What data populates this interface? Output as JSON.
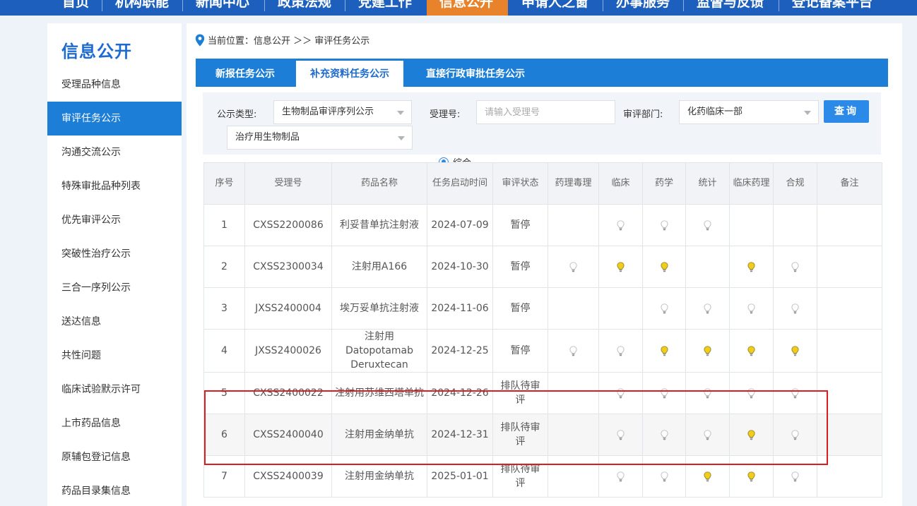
{
  "topnav": {
    "items": [
      {
        "label": "首页",
        "active": false
      },
      {
        "label": "机构职能",
        "active": false
      },
      {
        "label": "新闻中心",
        "active": false
      },
      {
        "label": "政策法规",
        "active": false
      },
      {
        "label": "党建工作",
        "active": false
      },
      {
        "label": "信息公开",
        "active": true
      },
      {
        "label": "申请人之窗",
        "active": false
      },
      {
        "label": "办事服务",
        "active": false
      },
      {
        "label": "监督与反馈",
        "active": false
      },
      {
        "label": "登记备案平台",
        "active": false
      }
    ]
  },
  "sidebar": {
    "title": "信息公开",
    "items": [
      {
        "label": "受理品种信息",
        "active": false
      },
      {
        "label": "审评任务公示",
        "active": true
      },
      {
        "label": "沟通交流公示",
        "active": false
      },
      {
        "label": "特殊审批品种列表",
        "active": false
      },
      {
        "label": "优先审评公示",
        "active": false
      },
      {
        "label": "突破性治疗公示",
        "active": false
      },
      {
        "label": "三合一序列公示",
        "active": false
      },
      {
        "label": "送达信息",
        "active": false
      },
      {
        "label": "共性问题",
        "active": false
      },
      {
        "label": "临床试验默示许可",
        "active": false
      },
      {
        "label": "上市药品信息",
        "active": false
      },
      {
        "label": "原辅包登记信息",
        "active": false
      },
      {
        "label": "药品目录集信息",
        "active": false
      }
    ]
  },
  "breadcrumb": {
    "text": "当前位置：信息公开 ＞＞ 审评任务公示"
  },
  "tabs": [
    {
      "label": "新报任务公示",
      "active": false
    },
    {
      "label": "补充资料任务公示",
      "active": true
    },
    {
      "label": "直接行政审批任务公示",
      "active": false
    }
  ],
  "filter": {
    "type_label": "公示类型:",
    "type_value": "生物制品审评序列公示",
    "subtype_value": "治疗用生物制品",
    "accept_label": "受理号:",
    "accept_placeholder": "请输入受理号",
    "dept_label": "审评部门:",
    "dept_value": "化药临床一部",
    "query_button": "查询",
    "radio_label": "综合"
  },
  "table": {
    "headers": [
      "序号",
      "受理号",
      "药品名称",
      "任务启动时间",
      "审评状态",
      "药理毒理",
      "临床",
      "药学",
      "统计",
      "临床药理",
      "合规",
      "备注"
    ],
    "rows": [
      {
        "no": "1",
        "accept": "CXSS2200086",
        "name": "利妥昔单抗注射液",
        "date": "2024-07-09",
        "status": "暂停",
        "bulbs": [
          "none",
          "gray",
          "gray",
          "gray",
          "none",
          "none"
        ],
        "note": ""
      },
      {
        "no": "2",
        "accept": "CXSS2300034",
        "name": "注射用A166",
        "date": "2024-10-30",
        "status": "暂停",
        "bulbs": [
          "gray",
          "yellow",
          "yellow",
          "none",
          "yellow",
          "gray"
        ],
        "note": ""
      },
      {
        "no": "3",
        "accept": "JXSS2400004",
        "name": "埃万妥单抗注射液",
        "date": "2024-11-06",
        "status": "暂停",
        "bulbs": [
          "none",
          "none",
          "gray",
          "gray",
          "gray",
          "gray"
        ],
        "note": ""
      },
      {
        "no": "4",
        "accept": "JXSS2400026",
        "name": "注射用 Datopotamab Deruxtecan",
        "date": "2024-12-25",
        "status": "暂停",
        "bulbs": [
          "gray",
          "gray",
          "yellow",
          "yellow",
          "yellow",
          "yellow"
        ],
        "note": ""
      },
      {
        "no": "5",
        "accept": "CXSS2400022",
        "name": "注射用苏维西塔单抗",
        "date": "2024-12-26",
        "status": "排队待审评",
        "bulbs": [
          "none",
          "gray",
          "gray",
          "gray",
          "gray",
          "gray"
        ],
        "note": ""
      },
      {
        "no": "6",
        "accept": "CXSS2400040",
        "name": "注射用金纳单抗",
        "date": "2024-12-31",
        "status": "排队待审评",
        "bulbs": [
          "none",
          "gray",
          "gray",
          "gray",
          "yellow",
          "gray"
        ],
        "note": ""
      },
      {
        "no": "7",
        "accept": "CXSS2400039",
        "name": "注射用金纳单抗",
        "date": "2025-01-01",
        "status": "排队待审评",
        "bulbs": [
          "none",
          "gray",
          "gray",
          "yellow",
          "yellow",
          "gray"
        ],
        "note": ""
      }
    ]
  },
  "colors": {
    "nav_blue": "#1c5fbc",
    "nav_active": "#e8832b",
    "accent_blue": "#1c7ed6",
    "bulb_yellow": "#f0cc1c",
    "bulb_gray": "#bdbdbd",
    "highlight_red": "#d81e1e"
  }
}
